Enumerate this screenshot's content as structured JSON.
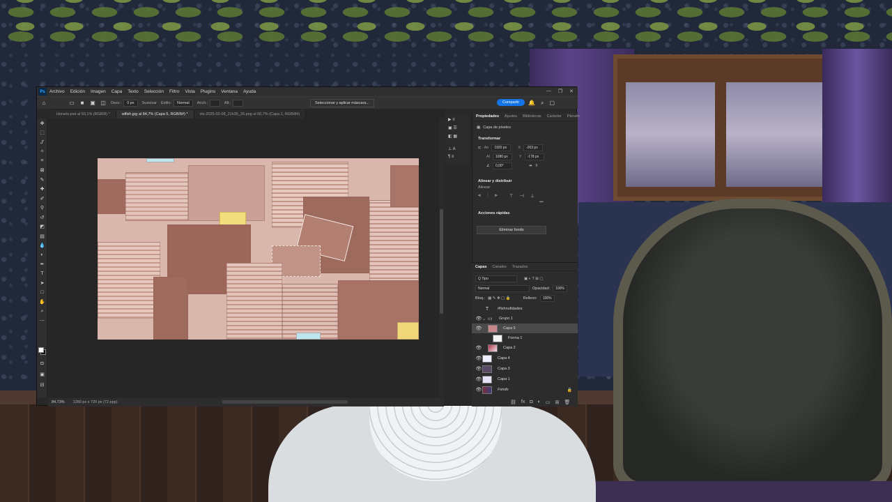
{
  "app": {
    "logo": "Ps",
    "menu": [
      "Archivo",
      "Edición",
      "Imagen",
      "Capa",
      "Texto",
      "Selección",
      "Filtro",
      "Vista",
      "Plugins",
      "Ventana",
      "Ayuda"
    ],
    "window_controls": [
      "—",
      "❐",
      "✕"
    ]
  },
  "options_bar": {
    "home_icon": "home-icon",
    "difum_label": "Desv.:",
    "difum_value": "0 px",
    "suavizar_label": "Suavizar",
    "estilo_label": "Estilo:",
    "estilo_value": "Normal",
    "ancho_label": "Anch.:",
    "alto_label": "Alt.:",
    "select_mask": "Seleccionar y aplicar máscara...",
    "share": "Compartir",
    "accent_color": "#1473e6"
  },
  "tabs": [
    {
      "label": "Horario.psd al 50,1% (RGB/8) *",
      "active": false
    },
    {
      "label": "wlfish.jpg al 84,7% (Capa 5, RGB/8#) *",
      "active": true
    },
    {
      "label": "vts-2025-02-08_21h35_26.png al 66,7% (Capa 1, RGB/8#)",
      "active": false
    }
  ],
  "status": {
    "zoom": "84,73%",
    "dimensions": "1280 px x 720 px (72 ppp)"
  },
  "properties": {
    "tabs": [
      "Propiedades",
      "Ajustes",
      "Bibliotecas",
      "Carácter",
      "Párrafo"
    ],
    "layer_kind": "Capa de píxeles",
    "transform_title": "Transformar",
    "w": "1920 px",
    "x": "-263 px",
    "h": "1080 px",
    "y": "-178 px",
    "angle": "0,00°",
    "align_title": "Alinear y distribuir",
    "align_sub": "Alinear:",
    "quick_title": "Acciones rápidas",
    "remove_bg": "Eliminar fondo"
  },
  "layers": {
    "tabs": [
      "Capas",
      "Canales",
      "Trazados"
    ],
    "filter_kind": "Q Tipo",
    "blend_mode": "Normal",
    "opacity_label": "Opacidad:",
    "opacity_value": "100%",
    "lock_label": "Bloq.:",
    "fill_label": "Relleno:",
    "fill_value": "100%",
    "items": [
      {
        "name": "#fishnufidades",
        "type": "text",
        "visible": false
      },
      {
        "name": "Grupo 1",
        "type": "group",
        "visible": true
      },
      {
        "name": "Capa 5",
        "type": "pixel",
        "visible": true,
        "selected": true
      },
      {
        "name": "Forma 1",
        "type": "shape",
        "visible": false
      },
      {
        "name": "Capa 2",
        "type": "pixel",
        "visible": true
      },
      {
        "name": "Capa 4",
        "type": "pixel",
        "visible": true
      },
      {
        "name": "Capa 3",
        "type": "pixel",
        "visible": true
      },
      {
        "name": "Capa 1",
        "type": "pixel",
        "visible": true
      },
      {
        "name": "Fondo",
        "type": "background",
        "visible": true
      }
    ]
  }
}
